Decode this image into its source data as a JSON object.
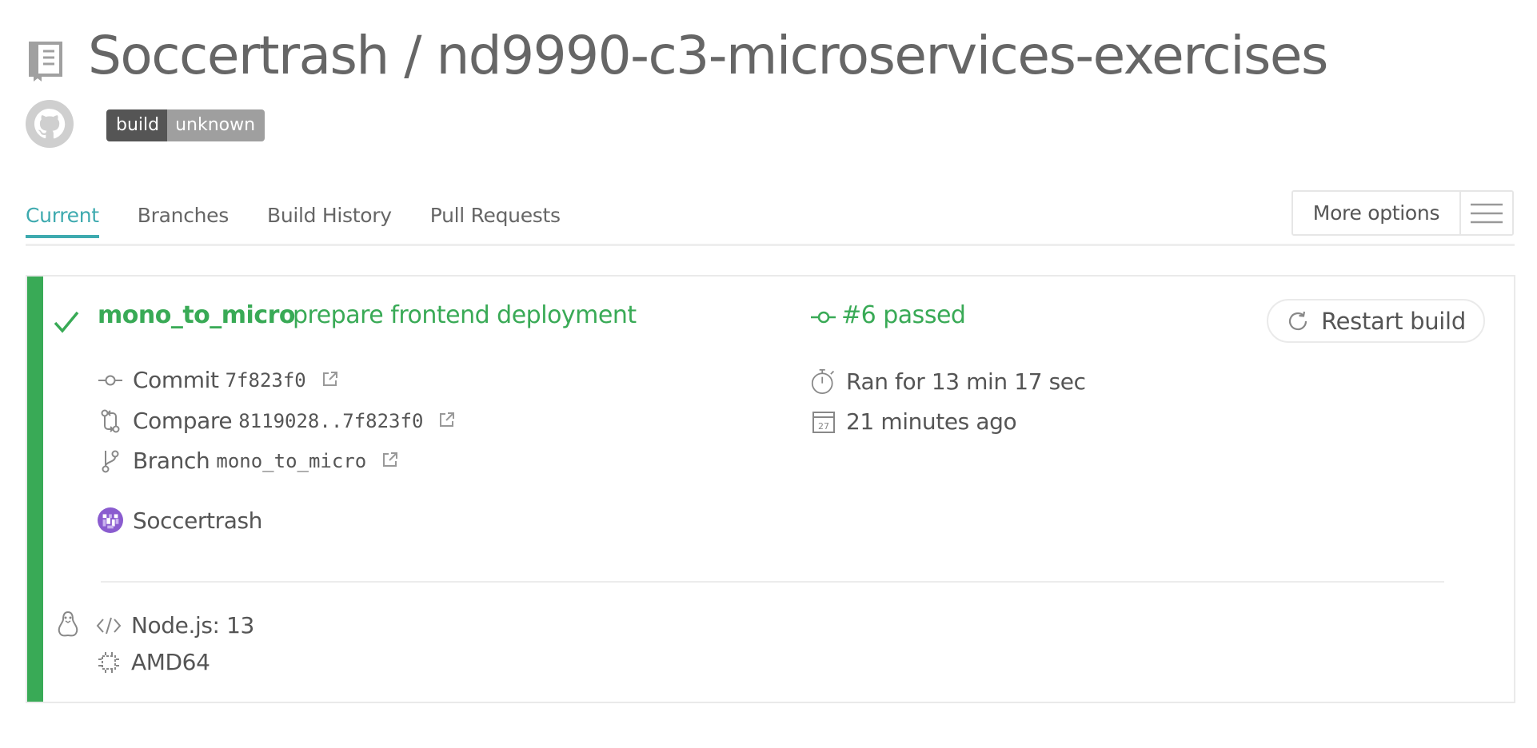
{
  "repo": {
    "title": "Soccertrash / nd9990-c3-microservices-exercises",
    "badge_left": "build",
    "badge_right": "unknown"
  },
  "tabs": [
    {
      "label": "Current",
      "active": true
    },
    {
      "label": "Branches",
      "active": false
    },
    {
      "label": "Build History",
      "active": false
    },
    {
      "label": "Pull Requests",
      "active": false
    }
  ],
  "more_options": {
    "label": "More options",
    "icon": "hamburger-icon"
  },
  "build": {
    "branch": "mono_to_micro",
    "message": "prepare frontend deployment",
    "status": "#6 passed",
    "restart_label": "Restart build",
    "commit_label": "Commit",
    "commit_sha": "7f823f0",
    "compare_label": "Compare",
    "compare_range": "8119028..7f823f0",
    "branch_label": "Branch",
    "branch_value": "mono_to_micro",
    "author": "Soccertrash",
    "duration": "Ran for 13 min 17 sec",
    "calendar_day": "27",
    "finished": "21 minutes ago",
    "language": "Node.js: 13",
    "arch": "AMD64"
  },
  "colors": {
    "passed": "#39aa56",
    "accent": "#3eaaaf",
    "text": "#555555"
  }
}
